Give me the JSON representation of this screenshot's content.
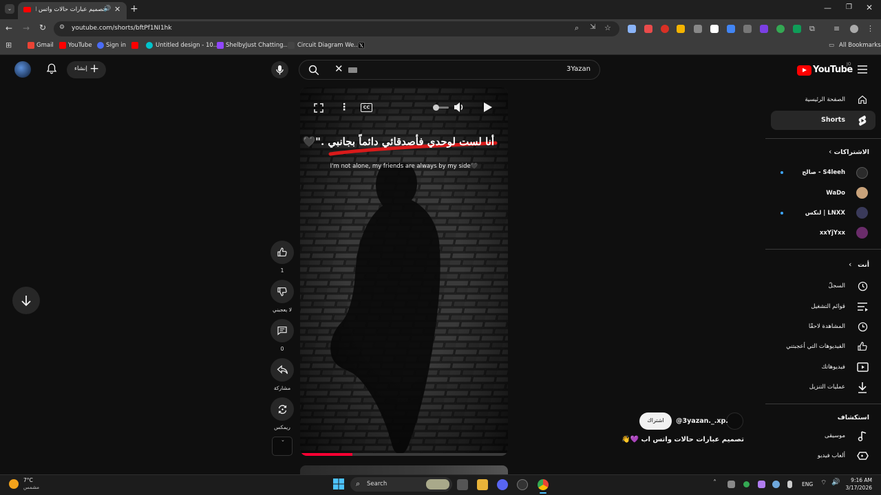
{
  "browser": {
    "tab_title": "تصميم عبارات حالات واتس ا...",
    "url": "youtube.com/shorts/bftPf1NI1hk",
    "bookmarks": [
      "Gmail",
      "YouTube",
      "Sign in",
      "Untitled design - 10...",
      "ShelbyJust Chatting...",
      "Circuit Diagram We..."
    ],
    "all_bookmarks": "All Bookmarks"
  },
  "youtube": {
    "logo_text": "YouTube",
    "logo_country": "JO",
    "create_label": "إنشاء",
    "search_value": "3Yazan",
    "nav": {
      "home": "الصفحة الرئيسية",
      "shorts": "Shorts",
      "subscriptions_header": "الاشتراكات",
      "subscriptions": [
        "صالح - S4leeh",
        "WaDo",
        "لنكس | LNXX",
        "xxYjYxx"
      ],
      "you_header": "أنت",
      "you_items": [
        "السجلّ",
        "قوائم التشغيل",
        "المشاهدة لاحقًا",
        "الفيديوهات التي أعجبتني",
        "فيديوهاتك",
        "عمليات التنزيل"
      ],
      "explore_header": "استكشاف",
      "explore_items": [
        "موسيقى",
        "ألعاب فيديو"
      ]
    },
    "video": {
      "caption_ar": "أنا لست لوحدي فأصدقائي دائماً بجانبي .\"🖤",
      "caption_en": "I'm not alone, my friends are always by my side🖤",
      "progress": 0.25
    },
    "actions": {
      "like_count": "1",
      "dislike_label": "لا يعجبني",
      "comment_count": "0",
      "share_label": "مشاركة",
      "remix_label": "ريمكس"
    },
    "channel": {
      "handle": "@3yazan._.xp.",
      "subscribe_label": "اشتراك",
      "title": "تصميم عبارات حالات واتس اب 💜👋"
    }
  },
  "taskbar": {
    "weather_temp": "7°C",
    "weather_desc": "مشمس",
    "search_label": "Search",
    "lang": "ENG",
    "time": "9:16 AM",
    "date": "3/17/2026"
  }
}
